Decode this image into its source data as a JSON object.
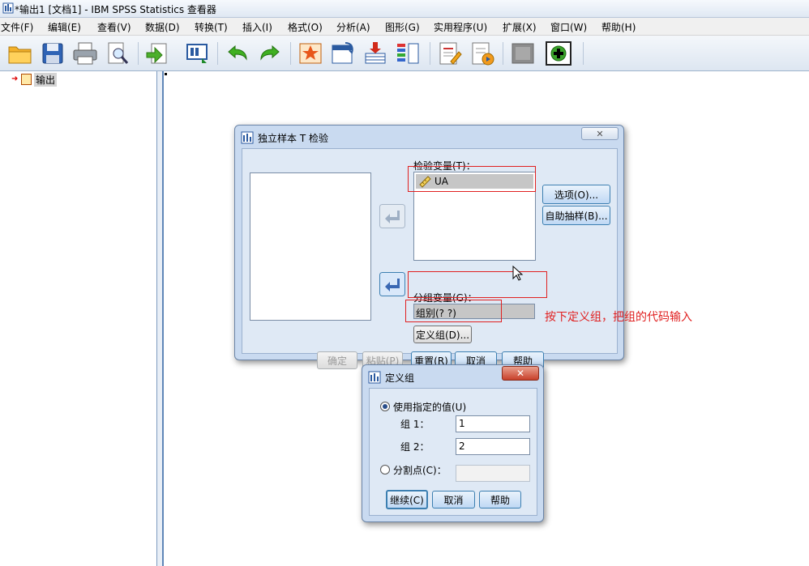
{
  "window": {
    "title": "*输出1 [文档1] - IBM SPSS Statistics 查看器"
  },
  "menu": [
    {
      "label": "文件(F)"
    },
    {
      "label": "编辑(E)"
    },
    {
      "label": "查看(V)"
    },
    {
      "label": "数据(D)"
    },
    {
      "label": "转换(T)"
    },
    {
      "label": "插入(I)"
    },
    {
      "label": "格式(O)"
    },
    {
      "label": "分析(A)"
    },
    {
      "label": "图形(G)"
    },
    {
      "label": "实用程序(U)"
    },
    {
      "label": "扩展(X)"
    },
    {
      "label": "窗口(W)"
    },
    {
      "label": "帮助(H)"
    }
  ],
  "toolbar_icons": [
    "open-folder-icon",
    "save-icon",
    "print-icon",
    "print-preview-icon",
    "export-icon",
    "recall-dialog-icon",
    "undo-icon",
    "redo-icon",
    "goto-case-icon",
    "goto-variable-icon",
    "insert-output-icon",
    "variables-icon",
    "create-title-icon",
    "insert-text-icon",
    "designate-window-icon",
    "add-icon"
  ],
  "tree": {
    "label": "输出"
  },
  "ttest_dialog": {
    "title": "独立样本 T 检验",
    "test_var_label": "检验变量(T)：",
    "test_var_item": "UA",
    "group_var_label": "分组变量(G)：",
    "group_var_value": "组别(? ?)",
    "define_groups_button": "定义组(D)...",
    "options_button": "选项(O)...",
    "bootstrap_button": "自助抽样(B)...",
    "ok_button": "确定",
    "paste_button": "粘贴(P)",
    "reset_button": "重置(R)",
    "cancel_button": "取消",
    "help_button": "帮助"
  },
  "annotation": {
    "text": "按下定义组，把组的代码输入",
    "color": "#e02020"
  },
  "define_dialog": {
    "title": "定义组",
    "use_values_label": "使用指定的值(U)",
    "group1_label": "组 1：",
    "group1_value": "1",
    "group2_label": "组 2：",
    "group2_value": "2",
    "cutpoint_label": "分割点(C)：",
    "cutpoint_value": "",
    "continue_button": "继续(C)",
    "cancel_button": "取消",
    "help_button": "帮助"
  }
}
